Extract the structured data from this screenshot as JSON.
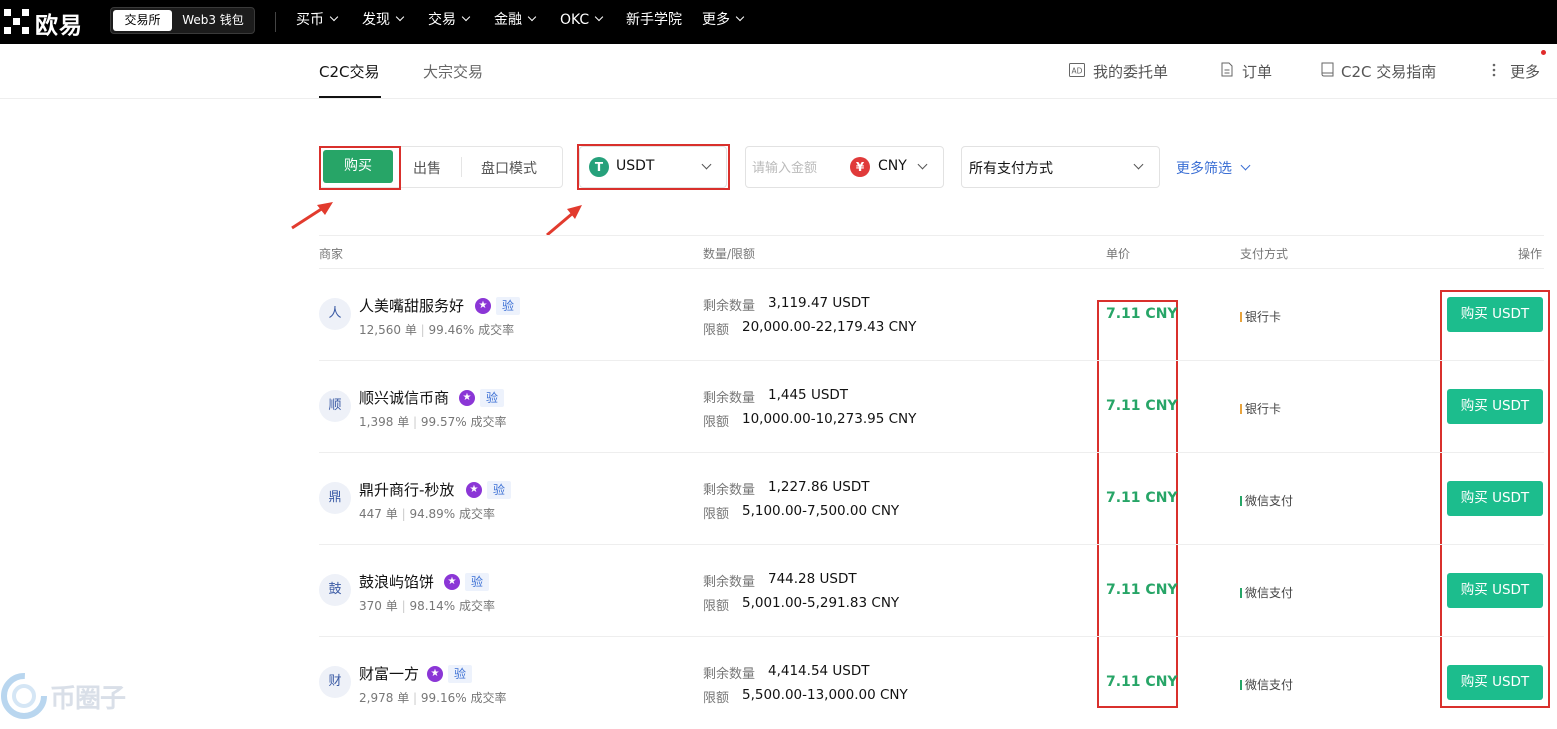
{
  "brand": {
    "name": "欧易"
  },
  "mode_switch": {
    "exchange": "交易所",
    "wallet": "Web3 钱包"
  },
  "nav": [
    {
      "label": "买币",
      "has_dropdown": true
    },
    {
      "label": "发现",
      "has_dropdown": true
    },
    {
      "label": "交易",
      "has_dropdown": true
    },
    {
      "label": "金融",
      "has_dropdown": true
    },
    {
      "label": "OKC",
      "has_dropdown": true
    },
    {
      "label": "新手学院",
      "has_dropdown": false
    },
    {
      "label": "更多",
      "has_dropdown": true
    }
  ],
  "subnav": {
    "tabs": [
      {
        "label": "C2C交易",
        "active": true
      },
      {
        "label": "大宗交易",
        "active": false
      }
    ],
    "links": {
      "my_ads": "我的委托单",
      "orders": "订单",
      "guide": "C2C 交易指南",
      "more": "更多"
    },
    "ad_icon_text": "AD"
  },
  "filters": {
    "side_buy": "购买",
    "side_sell": "出售",
    "book_mode": "盘口模式",
    "coin": "USDT",
    "coin_icon": "T",
    "amount_placeholder": "请输入金额",
    "fiat": "CNY",
    "fiat_icon": "¥",
    "payment": "所有支付方式",
    "more_filters": "更多筛选"
  },
  "table": {
    "headers": {
      "merchant": "商家",
      "quantity": "数量/限额",
      "price": "单价",
      "payment": "支付方式",
      "action": "操作"
    },
    "qty_label": "剩余数量",
    "limit_label": "限额",
    "order_unit": "单",
    "rate_suffix": "成交率",
    "verified_badge": "验",
    "rows": [
      {
        "avatar": "人",
        "name": "人美嘴甜服务好",
        "orders": "12,560",
        "rate": "99.46%",
        "qty": "3,119.47 USDT",
        "limit": "20,000.00-22,179.43 CNY",
        "price": "7.11 CNY",
        "payment": "银行卡",
        "pay_color": "#e8a33c",
        "action": "购买 USDT"
      },
      {
        "avatar": "顺",
        "name": "顺兴诚信币商",
        "orders": "1,398",
        "rate": "99.57%",
        "qty": "1,445 USDT",
        "limit": "10,000.00-10,273.95 CNY",
        "price": "7.11 CNY",
        "payment": "银行卡",
        "pay_color": "#e8a33c",
        "action": "购买 USDT"
      },
      {
        "avatar": "鼎",
        "name": "鼎升商行-秒放",
        "orders": "447",
        "rate": "94.89%",
        "qty": "1,227.86 USDT",
        "limit": "5,100.00-7,500.00 CNY",
        "price": "7.11 CNY",
        "payment": "微信支付",
        "pay_color": "#27a567",
        "action": "购买 USDT"
      },
      {
        "avatar": "鼓",
        "name": "鼓浪屿馅饼",
        "orders": "370",
        "rate": "98.14%",
        "qty": "744.28 USDT",
        "limit": "5,001.00-5,291.83 CNY",
        "price": "7.11 CNY",
        "payment": "微信支付",
        "pay_color": "#27a567",
        "action": "购买 USDT"
      },
      {
        "avatar": "财",
        "name": "财富一方",
        "orders": "2,978",
        "rate": "99.16%",
        "qty": "4,414.54 USDT",
        "limit": "5,500.00-13,000.00 CNY",
        "price": "7.11 CNY",
        "payment": "微信支付",
        "pay_color": "#27a567",
        "action": "购买 USDT"
      }
    ]
  },
  "watermark": {
    "text": "币圈子"
  }
}
